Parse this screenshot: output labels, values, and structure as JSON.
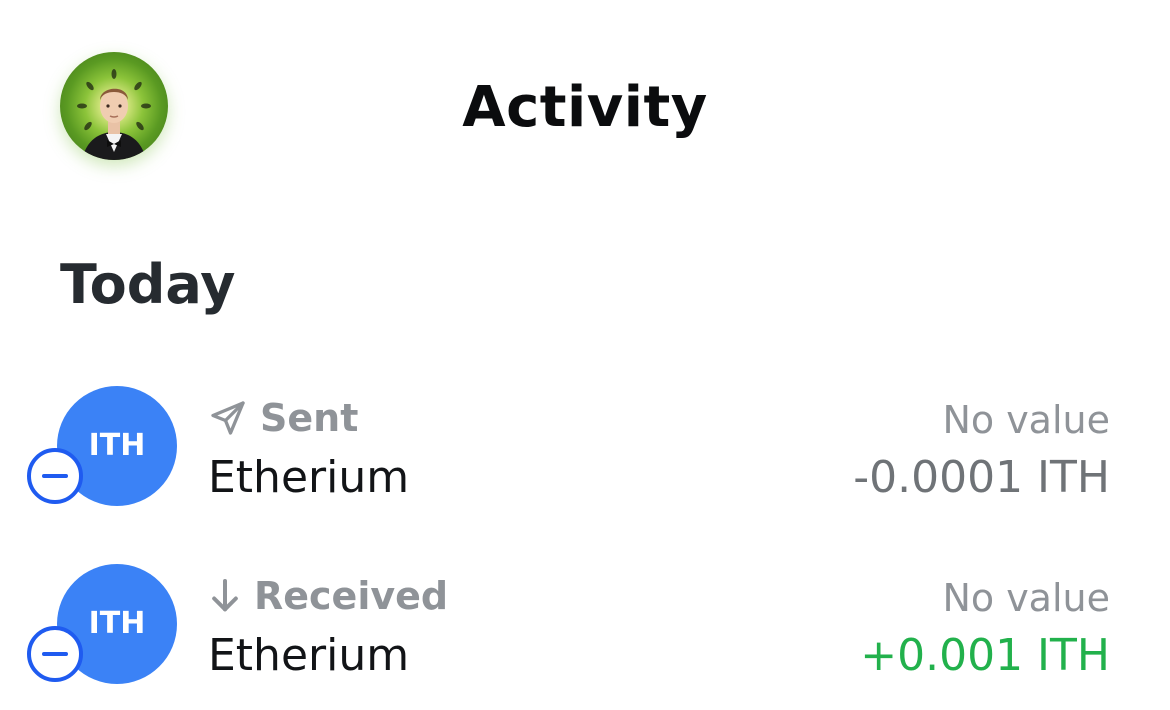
{
  "header": {
    "title": "Activity",
    "avatar_icon": "avatar-photo-icon"
  },
  "section": {
    "title": "Today"
  },
  "activities": [
    {
      "type_label": "Sent",
      "type_icon": "send-arrow-icon",
      "token_symbol": "ITH",
      "asset_name": "Etherium",
      "fiat_value": "No value",
      "amount": "-0.0001 ITH",
      "amount_color": "#6f7377",
      "status_icon": "pending-minus-icon"
    },
    {
      "type_label": "Received",
      "type_icon": "arrow-down-icon",
      "token_symbol": "ITH",
      "asset_name": "Etherium",
      "fiat_value": "No value",
      "amount": "+0.001 ITH",
      "amount_color": "#22b14c",
      "status_icon": "pending-minus-icon"
    }
  ],
  "colors": {
    "token_blue": "#3b82f6",
    "status_blue": "#1f5bf0",
    "muted_text": "#8f9398",
    "received_green": "#22b14c"
  }
}
